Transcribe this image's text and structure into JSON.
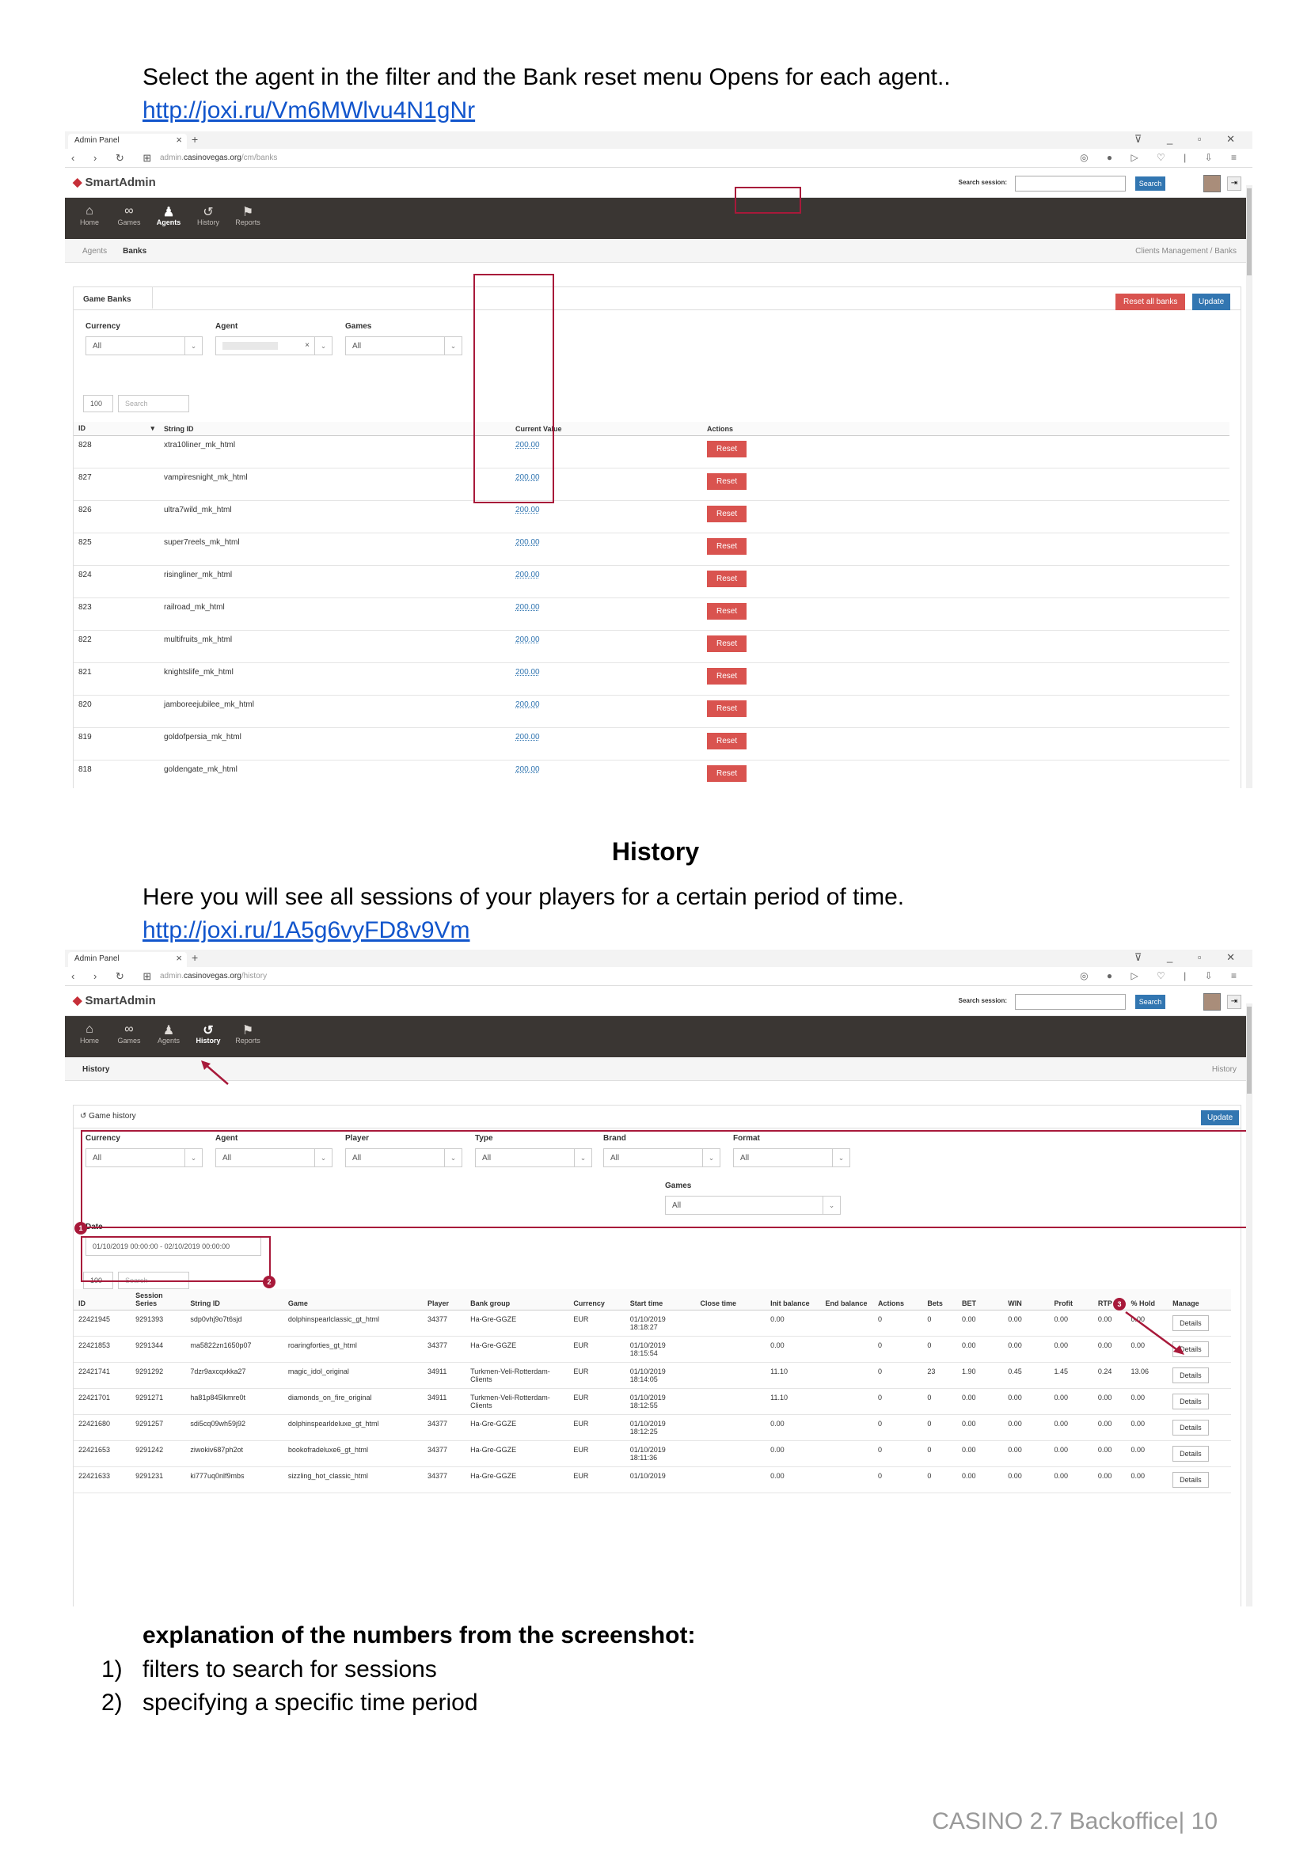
{
  "section1": {
    "intro": "Select the agent in the filter and the Bank reset menu Opens for each agent..",
    "link": "http://joxi.ru/Vm6MWlvu4N1gNr"
  },
  "browser": {
    "tab_title": "Admin Panel",
    "url_domain": "casinovegas.org",
    "url_prefix": "admin.",
    "url_path_banks": "/cm/banks",
    "url_path_history": "/history"
  },
  "app": {
    "logo": "SmartAdmin",
    "search_session_label": "Search session:",
    "search_button": "Search",
    "menu": [
      "Home",
      "Games",
      "Agents",
      "History",
      "Reports"
    ]
  },
  "banks": {
    "crumb_tabs": [
      "Agents",
      "Banks"
    ],
    "breadcrumb": "Clients Management / Banks",
    "panel_tab": "Game Banks",
    "reset_all": "Reset all banks",
    "update": "Update",
    "filters": [
      {
        "label": "Currency",
        "value": "All"
      },
      {
        "label": "Agent",
        "value": ""
      },
      {
        "label": "Games",
        "value": "All"
      }
    ],
    "page_size": "100",
    "search_placeholder": "Search",
    "columns": [
      "ID",
      "String ID",
      "Current Value",
      "Actions"
    ],
    "reset_label": "Reset",
    "rows": [
      [
        "828",
        "xtra10liner_mk_html",
        "200.00"
      ],
      [
        "827",
        "vampiresnight_mk_html",
        "200.00"
      ],
      [
        "826",
        "ultra7wild_mk_html",
        "200.00"
      ],
      [
        "825",
        "super7reels_mk_html",
        "200.00"
      ],
      [
        "824",
        "risingliner_mk_html",
        "200.00"
      ],
      [
        "823",
        "railroad_mk_html",
        "200.00"
      ],
      [
        "822",
        "multifruits_mk_html",
        "200.00"
      ],
      [
        "821",
        "knightslife_mk_html",
        "200.00"
      ],
      [
        "820",
        "jamboreejubilee_mk_html",
        "200.00"
      ],
      [
        "819",
        "goldofpersia_mk_html",
        "200.00"
      ],
      [
        "818",
        "goldengate_mk_html",
        "200.00"
      ]
    ]
  },
  "section2": {
    "heading": "History",
    "intro": "Here you will see all sessions of your players for a certain period of time.",
    "link": "http://joxi.ru/1A5g6vyFD8v9Vm"
  },
  "history": {
    "crumb_tab": "History",
    "breadcrumb": "History",
    "panel_title": "Game history",
    "update": "Update",
    "filters": [
      {
        "label": "Currency",
        "value": "All"
      },
      {
        "label": "Agent",
        "value": "All"
      },
      {
        "label": "Player",
        "value": "All"
      },
      {
        "label": "Type",
        "value": "All"
      },
      {
        "label": "Brand",
        "value": "All"
      },
      {
        "label": "Format",
        "value": "All"
      }
    ],
    "games_filter": {
      "label": "Games",
      "value": "All"
    },
    "date_label": "Date",
    "date_value": "01/10/2019 00:00:00 - 02/10/2019 00:00:00",
    "page_size": "100",
    "search_placeholder": "Search",
    "markers": [
      "1",
      "2",
      "3"
    ],
    "columns": [
      "ID",
      "Session Series",
      "String ID",
      "Game",
      "Player",
      "Bank group",
      "Currency",
      "Start time",
      "Close time",
      "Init balance",
      "End balance",
      "Actions",
      "Bets",
      "BET",
      "WIN",
      "Profit",
      "RTP",
      "% Hold",
      "Manage"
    ],
    "details_label": "Details",
    "rows": [
      [
        "22421945",
        "9291393",
        "sdp0vhj9o7t6sjd",
        "dolphinspearlclassic_gt_html",
        "34377",
        "Ha-Gre-GGZE",
        "EUR",
        "01/10/2019 18:18:27",
        "",
        "0.00",
        "",
        "0",
        "0",
        "0.00",
        "0.00",
        "0.00",
        "0.00",
        "0.00"
      ],
      [
        "22421853",
        "9291344",
        "ma5822zn1650p07",
        "roaringforties_gt_html",
        "34377",
        "Ha-Gre-GGZE",
        "EUR",
        "01/10/2019 18:15:54",
        "",
        "0.00",
        "",
        "0",
        "0",
        "0.00",
        "0.00",
        "0.00",
        "0.00",
        "0.00"
      ],
      [
        "22421741",
        "9291292",
        "7dzr9axcqxkka27",
        "magic_idol_original",
        "34911",
        "Turkmen-Veli-Rotterdam-Clients",
        "EUR",
        "01/10/2019 18:14:05",
        "",
        "11.10",
        "",
        "0",
        "23",
        "1.90",
        "0.45",
        "1.45",
        "0.24",
        "13.06"
      ],
      [
        "22421701",
        "9291271",
        "ha81p845lkmre0t",
        "diamonds_on_fire_original",
        "34911",
        "Turkmen-Veli-Rotterdam-Clients",
        "EUR",
        "01/10/2019 18:12:55",
        "",
        "11.10",
        "",
        "0",
        "0",
        "0.00",
        "0.00",
        "0.00",
        "0.00",
        "0.00"
      ],
      [
        "22421680",
        "9291257",
        "sdi5cq09wh59j92",
        "dolphinspearldeluxe_gt_html",
        "34377",
        "Ha-Gre-GGZE",
        "EUR",
        "01/10/2019 18:12:25",
        "",
        "0.00",
        "",
        "0",
        "0",
        "0.00",
        "0.00",
        "0.00",
        "0.00",
        "0.00"
      ],
      [
        "22421653",
        "9291242",
        "ziwokiv687ph2ot",
        "bookofradeluxe6_gt_html",
        "34377",
        "Ha-Gre-GGZE",
        "EUR",
        "01/10/2019 18:11:36",
        "",
        "0.00",
        "",
        "0",
        "0",
        "0.00",
        "0.00",
        "0.00",
        "0.00",
        "0.00"
      ],
      [
        "22421633",
        "9291231",
        "ki777uq0nlf9mbs",
        "sizzling_hot_classic_html",
        "34377",
        "Ha-Gre-GGZE",
        "EUR",
        "01/10/2019",
        "",
        "0.00",
        "",
        "0",
        "0",
        "0.00",
        "0.00",
        "0.00",
        "0.00",
        "0.00"
      ]
    ]
  },
  "explanation": {
    "title": "explanation of the numbers from the screenshot:",
    "items": [
      {
        "num": "1)",
        "text": "filters to search for sessions"
      },
      {
        "num": "2)",
        "text": "specifying a specific time period"
      }
    ]
  },
  "footer": "CASINO 2.7 Backoffice| 10"
}
